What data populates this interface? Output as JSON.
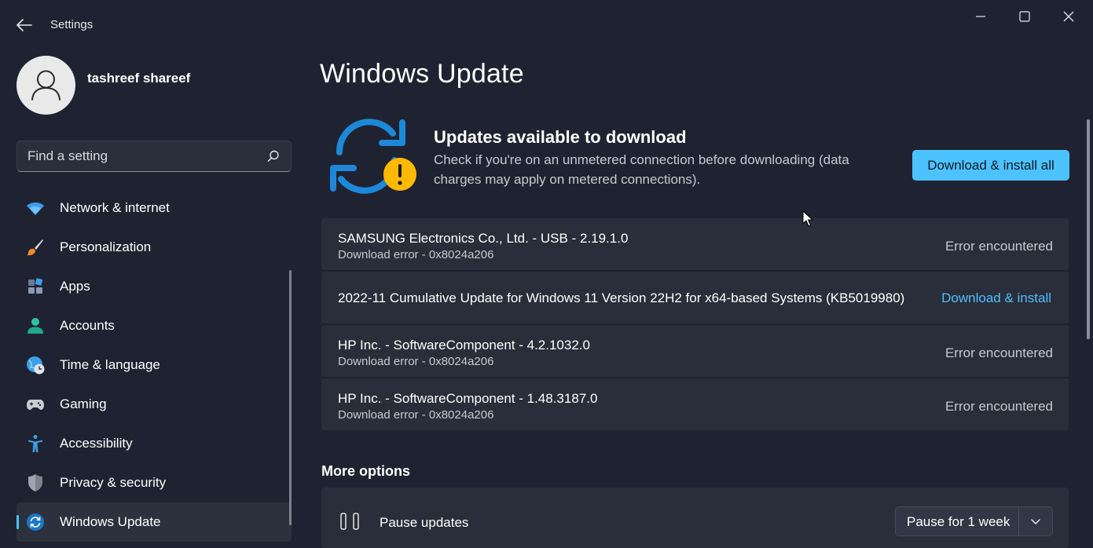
{
  "window": {
    "title": "Settings"
  },
  "user": {
    "name": "tashreef shareef"
  },
  "search": {
    "placeholder": "Find a setting"
  },
  "sidebar": {
    "items": [
      {
        "label": "Network & internet",
        "icon": "wifi-icon"
      },
      {
        "label": "Personalization",
        "icon": "brush-icon"
      },
      {
        "label": "Apps",
        "icon": "apps-icon"
      },
      {
        "label": "Accounts",
        "icon": "person-icon"
      },
      {
        "label": "Time & language",
        "icon": "globe-clock-icon"
      },
      {
        "label": "Gaming",
        "icon": "gamepad-icon"
      },
      {
        "label": "Accessibility",
        "icon": "accessibility-icon"
      },
      {
        "label": "Privacy & security",
        "icon": "shield-icon"
      },
      {
        "label": "Windows Update",
        "icon": "sync-icon",
        "selected": true
      }
    ]
  },
  "main": {
    "page_title": "Windows Update",
    "status_title": "Updates available to download",
    "status_desc": "Check if you're on an unmetered connection before downloading (data charges may apply on metered connections).",
    "primary_button": "Download & install all",
    "updates": [
      {
        "name": "SAMSUNG Electronics Co., Ltd.  - USB - 2.19.1.0",
        "sub": "Download error - 0x8024a206",
        "status": "Error encountered"
      },
      {
        "name": "2022-11 Cumulative Update for Windows 11 Version 22H2 for x64-based Systems (KB5019980)",
        "sub": "",
        "action": "Download & install"
      },
      {
        "name": "HP Inc. - SoftwareComponent - 4.2.1032.0",
        "sub": "Download error - 0x8024a206",
        "status": "Error encountered"
      },
      {
        "name": "HP Inc. - SoftwareComponent - 1.48.3187.0",
        "sub": "Download error - 0x8024a206",
        "status": "Error encountered"
      }
    ],
    "more_options": {
      "heading": "More options",
      "pause_label": "Pause updates",
      "pause_selected": "Pause for 1 week"
    }
  },
  "colors": {
    "background": "#1f2331",
    "card": "#2a2d3a",
    "accent": "#4cc2ff",
    "warning": "#ffb900"
  }
}
